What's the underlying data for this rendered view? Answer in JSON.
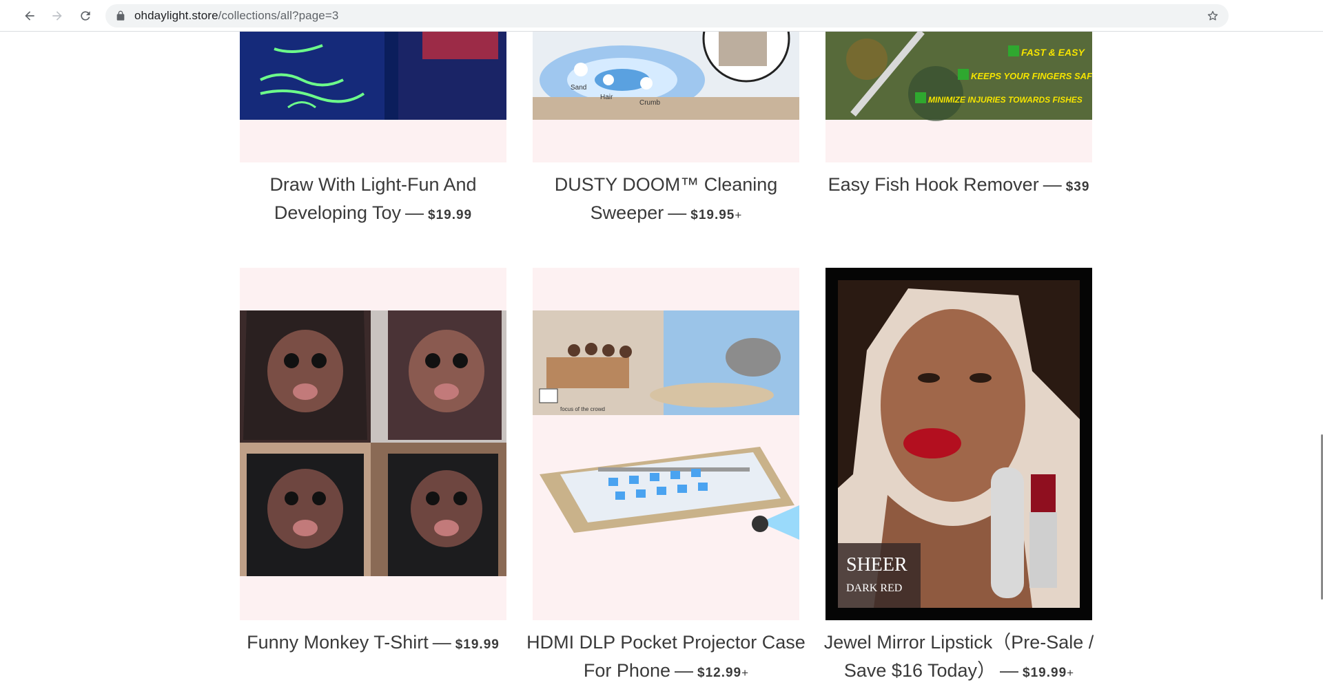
{
  "browser": {
    "url_host": "ohdaylight.store",
    "url_path": "/collections/all?page=3"
  },
  "products": [
    {
      "title": "Draw With Light-Fun And Developing Toy",
      "price": "$19.99",
      "price_suffix": ""
    },
    {
      "title": "DUSTY DOOM™ Cleaning Sweeper",
      "price": "$19.95",
      "price_suffix": "+"
    },
    {
      "title": "Easy Fish Hook Remover",
      "price": "$39",
      "price_suffix": ""
    },
    {
      "title": "Funny Monkey T-Shirt",
      "price": "$19.99",
      "price_suffix": ""
    },
    {
      "title": "HDMI DLP Pocket Projector Case For Phone",
      "price": "$12.99",
      "price_suffix": "+"
    },
    {
      "title": "Jewel Mirror Lipstick（Pre-Sale / Save $16 Today）",
      "price": "$19.99",
      "price_suffix": "+"
    }
  ],
  "image_text": {
    "sweeper_labels": [
      "Sand",
      "Hair",
      "Crumb"
    ],
    "fish_hook_badges": [
      "FAST & EASY",
      "KEEPS YOUR FINGERS SAFE",
      "MINIMIZE INJURIES TOWARDS FISHES"
    ],
    "projector_caption": "focus of the crowd",
    "lipstick_label_main": "SHEER",
    "lipstick_label_sub": "DARK RED"
  }
}
